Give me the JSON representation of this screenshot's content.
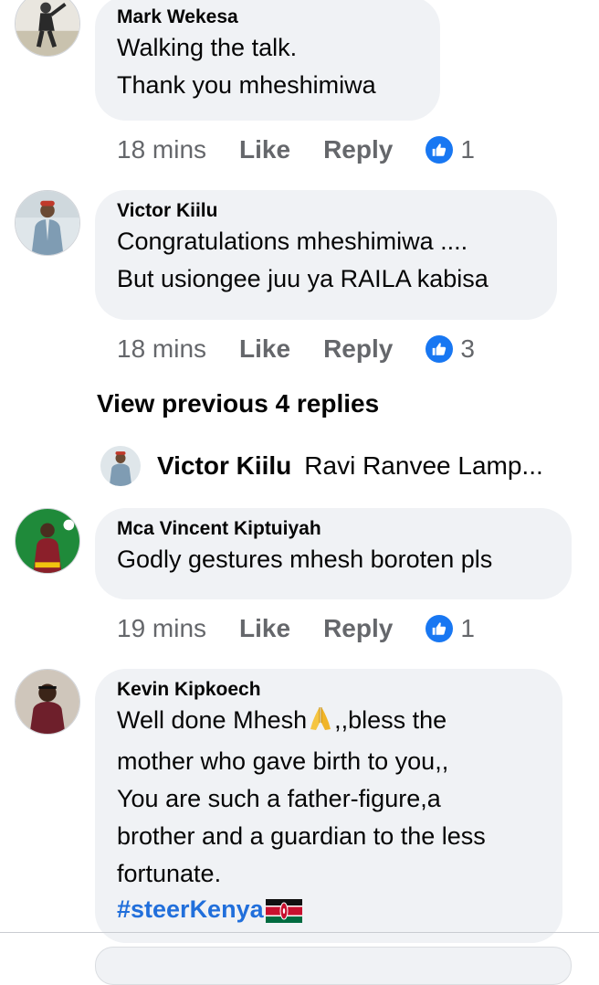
{
  "comments": [
    {
      "author": "Mark Wekesa",
      "lines": [
        "Walking the talk.",
        "Thank you mheshimiwa"
      ],
      "time": "18 mins",
      "like_label": "Like",
      "reply_label": "Reply",
      "reaction_count": "1"
    },
    {
      "author": "Victor Kiilu",
      "lines": [
        "Congratulations mheshimiwa ....",
        "But usiongee juu ya RAILA kabisa"
      ],
      "time": "18 mins",
      "like_label": "Like",
      "reply_label": "Reply",
      "reaction_count": "3"
    },
    {
      "author": "Mca Vincent Kiptuiyah",
      "lines": [
        "Godly gestures mhesh boroten pls"
      ],
      "time": "19 mins",
      "like_label": "Like",
      "reply_label": "Reply",
      "reaction_count": "1"
    },
    {
      "author": "Kevin Kipkoech",
      "line1_before_emoji": "Well done Mhesh",
      "line1_after_emoji": ",,bless the",
      "rest_lines": [
        "mother who gave birth to you,,",
        "You are such a father-figure,a",
        "brother and a guardian to the less",
        "fortunate."
      ],
      "hashtag": "#steerKenya"
    }
  ],
  "thread": {
    "view_previous_label": "View previous 4 replies",
    "preview_author": "Victor Kiilu",
    "preview_text": "Ravi Ranvee Lamp..."
  },
  "icons": {
    "reaction": "like-thumb-icon",
    "emoji_pray": "folded-hands-icon",
    "emoji_flag": "kenya-flag-icon"
  },
  "colors": {
    "bubble": "#f0f2f5",
    "secondary_text": "#65676b",
    "like_blue": "#1877f2",
    "hashtag": "#216fdb"
  }
}
